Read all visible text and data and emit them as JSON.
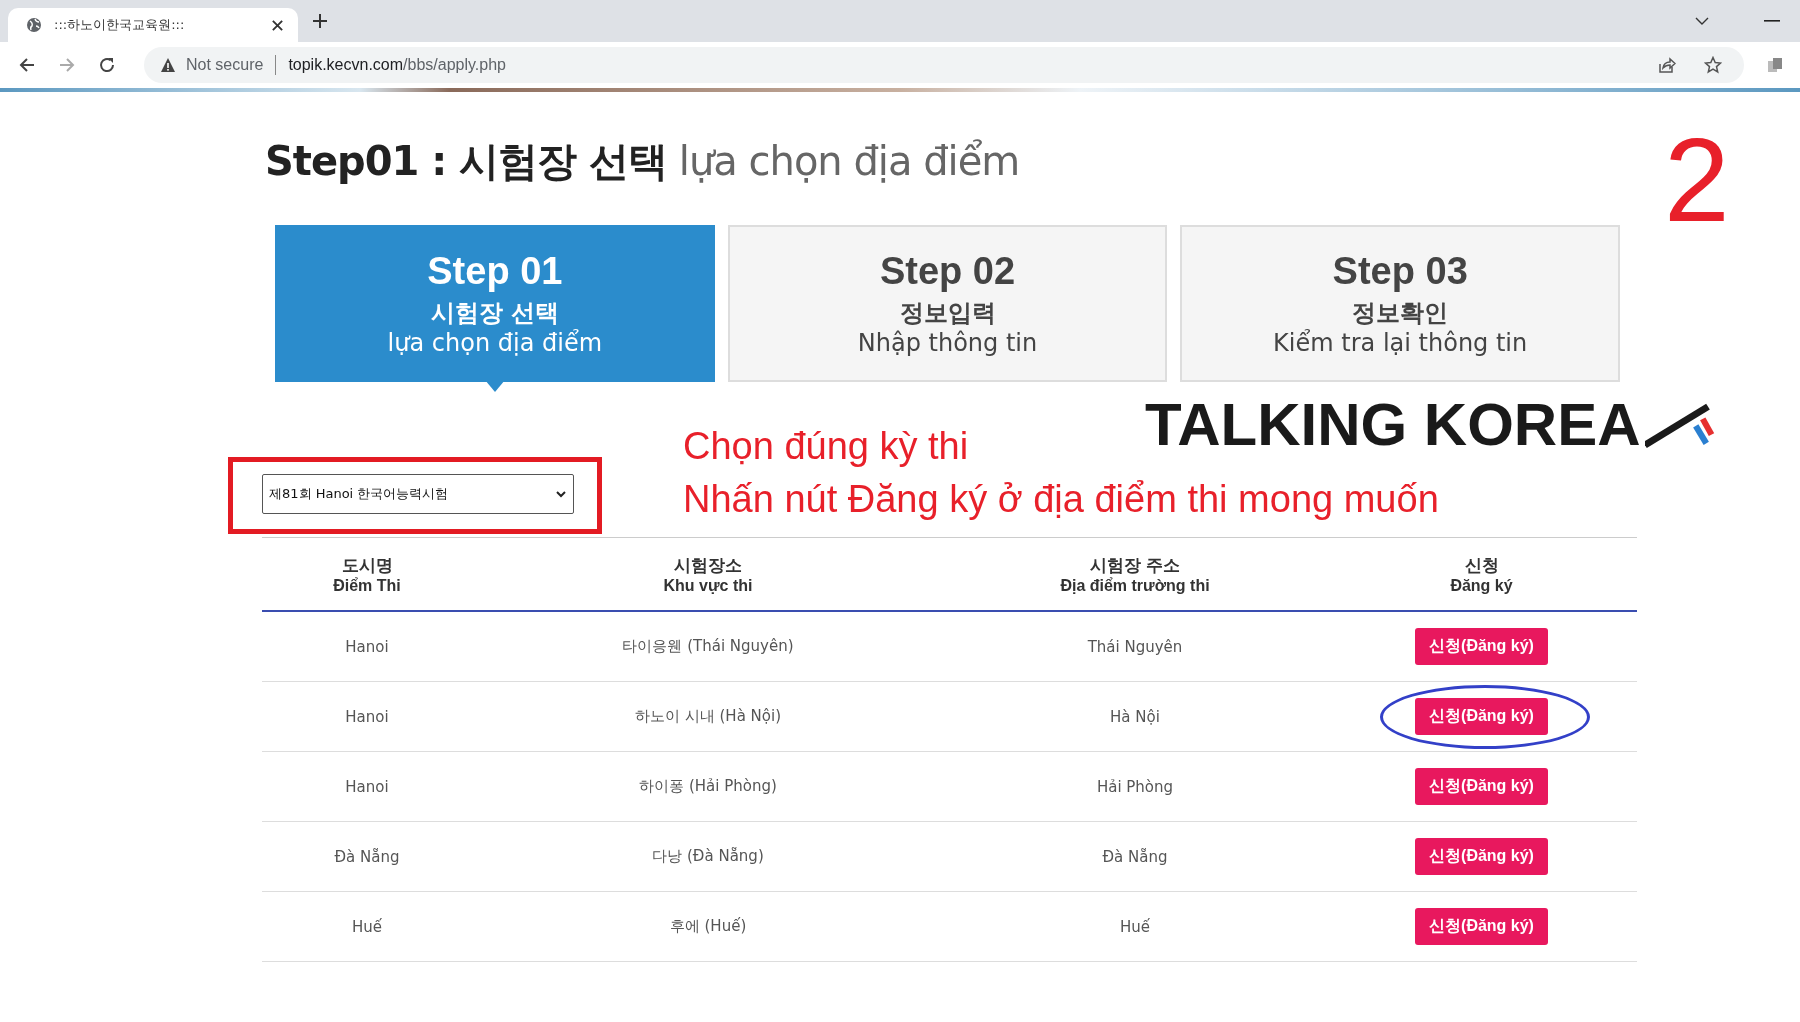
{
  "browser": {
    "tab_title": ":::하노이한국교육원:::",
    "security": "Not secure",
    "url_host": "topik.kecvn.com",
    "url_path": "/bbs/apply.php"
  },
  "page_title": {
    "main": "Step01 : 시험장 선택",
    "sub": "lựa chọn địa điểm"
  },
  "annotation_number": "2",
  "steps": [
    {
      "title": "Step 01",
      "ko": "시험장 선택",
      "vi": "lựa chọn địa điểm",
      "selected": true
    },
    {
      "title": "Step 02",
      "ko": "정보입력",
      "vi": "Nhập thông tin",
      "selected": false
    },
    {
      "title": "Step 03",
      "ko": "정보확인",
      "vi": "Kiểm tra lại thông tin",
      "selected": false
    }
  ],
  "logo": "TALKING KOREA",
  "instructions": [
    "Chọn đúng kỳ thi",
    "Nhấn nút Đăng ký ở địa điểm thi mong muốn"
  ],
  "exam_select": {
    "value": "제81회 Hanoi 한국어능력시험",
    "highlighted": true
  },
  "table": {
    "columns": [
      {
        "ko": "도시명",
        "vi": "Điểm Thi"
      },
      {
        "ko": "시험장소",
        "vi": "Khu vực thi"
      },
      {
        "ko": "시험장 주소",
        "vi": "Địa điểm trường thi"
      },
      {
        "ko": "신청",
        "vi": "Đăng ký"
      }
    ],
    "rows": [
      {
        "city": "Hanoi",
        "venue": "타이응웬 (Thái Nguyên)",
        "address": "Thái Nguyên",
        "button": "신청(Đăng ký)",
        "circled": false
      },
      {
        "city": "Hanoi",
        "venue": "하노이 시내 (Hà Nội)",
        "address": "Hà Nội",
        "button": "신청(Đăng ký)",
        "circled": true
      },
      {
        "city": "Hanoi",
        "venue": "하이퐁 (Hải Phòng)",
        "address": "Hải Phòng",
        "button": "신청(Đăng ký)",
        "circled": false
      },
      {
        "city": "Đà Nẵng",
        "venue": "다낭 (Đà Nẵng)",
        "address": "Đà Nẵng",
        "button": "신청(Đăng ký)",
        "circled": false
      },
      {
        "city": "Huế",
        "venue": "후에 (Huế)",
        "address": "Huế",
        "button": "신청(Đăng ký)",
        "circled": false
      }
    ]
  }
}
